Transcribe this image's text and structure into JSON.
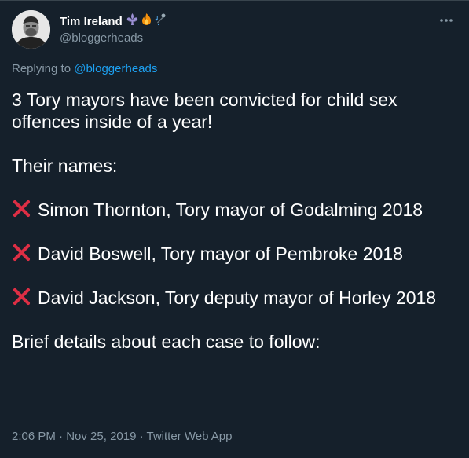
{
  "author": {
    "display_name": "Tim Ireland",
    "handle": "@bloggerheads",
    "emojis": [
      "fleur-de-lis-icon",
      "fire-icon",
      "microphone-notes-icon"
    ]
  },
  "reply": {
    "prefix": "Replying to",
    "mention": "@bloggerheads"
  },
  "tweet": {
    "intro": "3 Tory mayors have been convicted for child sex offences inside of a year!",
    "names_heading": "Their names:",
    "entries": [
      {
        "icon": "cross-mark-icon",
        "text": "Simon Thornton, Tory mayor of Godalming 2018"
      },
      {
        "icon": "cross-mark-icon",
        "text": "David Boswell, Tory mayor of Pembroke 2018"
      },
      {
        "icon": "cross-mark-icon",
        "text": "David Jackson, Tory deputy mayor of Horley 2018"
      }
    ],
    "outro": "Brief details about each case to follow:"
  },
  "meta": {
    "time": "2:06 PM",
    "sep1": " · ",
    "date": "Nov 25, 2019",
    "sep2": " · ",
    "source": "Twitter Web App"
  },
  "colors": {
    "background": "#15202b",
    "text": "#ffffff",
    "secondary": "#8899a6",
    "link": "#1da1f2",
    "cross": "#dd2e44"
  }
}
